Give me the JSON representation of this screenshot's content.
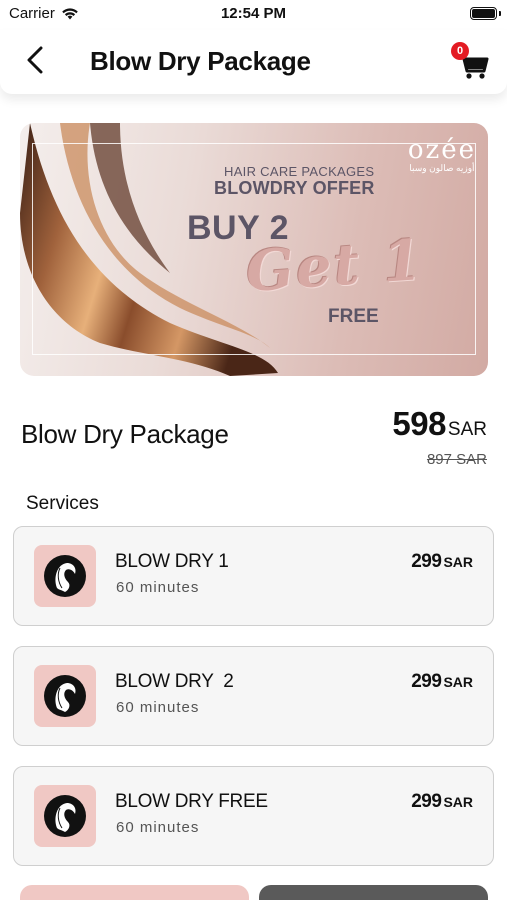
{
  "status_bar": {
    "carrier": "Carrier",
    "time": "12:54 PM",
    "battery_level": 1.0
  },
  "nav": {
    "title": "Blow Dry Package",
    "back_icon": "chevron-left-icon",
    "cart_icon": "cart-icon",
    "cart_count": "0"
  },
  "banner": {
    "brand": "ozée",
    "brand_sub": "أوزيه صالون وسبا",
    "line1": "HAIR CARE PACKAGES",
    "line2": "BLOWDRY OFFER",
    "buy": "BUY 2",
    "get": "Get 1",
    "free": "FREE"
  },
  "package": {
    "title": "Blow Dry Package",
    "price": "598",
    "currency": "SAR",
    "old_price": "897 SAR"
  },
  "services": {
    "title": "Services",
    "items": [
      {
        "name": "BLOW DRY 1",
        "duration": "60 minutes",
        "price": "299",
        "currency": "SAR",
        "icon": "woman-hair-icon"
      },
      {
        "name": "BLOW DRY  2",
        "duration": "60 minutes",
        "price": "299",
        "currency": "SAR",
        "icon": "woman-hair-icon"
      },
      {
        "name": "BLOW DRY FREE",
        "duration": "60 minutes",
        "price": "299",
        "currency": "SAR",
        "icon": "woman-hair-icon"
      }
    ]
  },
  "colors": {
    "accent_pink": "#f0c8c4",
    "dark_button": "#5a5a5a",
    "badge_red": "#e31b23"
  }
}
